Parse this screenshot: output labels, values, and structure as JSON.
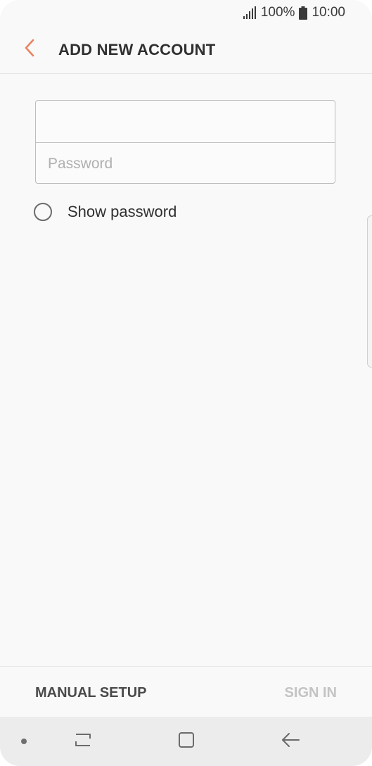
{
  "status_bar": {
    "battery": "100%",
    "time": "10:00",
    "icons": [
      "signal-icon",
      "battery-icon"
    ]
  },
  "app_bar": {
    "title": "ADD NEW ACCOUNT",
    "back_icon": "chevron-left-icon",
    "accent_color": "#e9835f"
  },
  "form": {
    "email_value": "",
    "email_placeholder": "",
    "password_value": "",
    "password_placeholder": "Password",
    "show_password_label": "Show password",
    "show_password_checked": false
  },
  "actions": {
    "manual_setup": "MANUAL SETUP",
    "sign_in": "SIGN IN",
    "sign_in_enabled": false
  },
  "nav_bar": {
    "icons": [
      "recent-apps-icon",
      "home-icon",
      "back-arrow-icon"
    ]
  }
}
